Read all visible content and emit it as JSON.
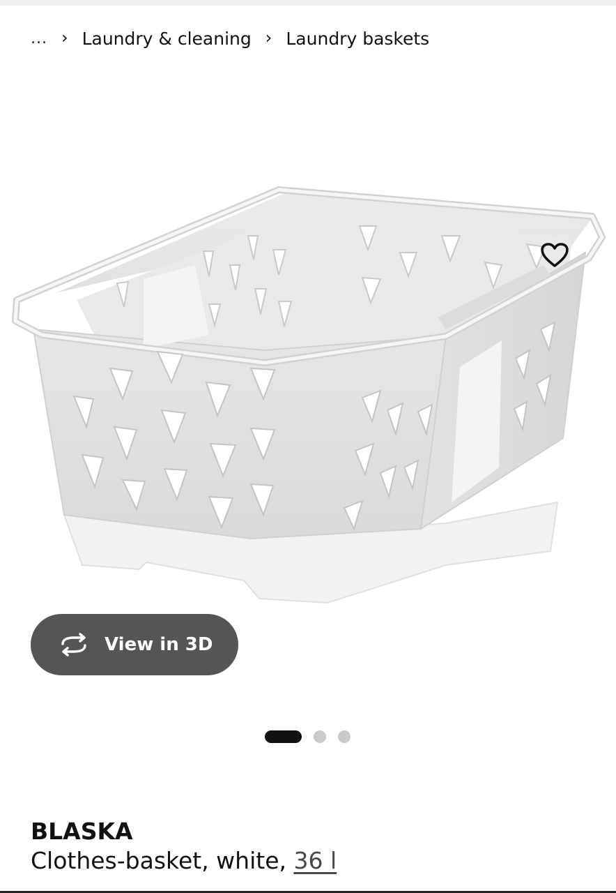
{
  "breadcrumb": {
    "more": "...",
    "items": [
      "Laundry & cleaning",
      "Laundry baskets"
    ]
  },
  "gallery": {
    "favorite_icon": "heart-outline-icon",
    "view3d_label": "View in 3D",
    "view3d_icon": "rotate-3d-icon",
    "slide_count": 3,
    "active_slide": 1
  },
  "product": {
    "name": "BLASKA",
    "description": "Clothes-basket, white, ",
    "size": "36 l"
  },
  "colors": {
    "button_bg": "#555555",
    "active_dot": "#111111",
    "inactive_dot": "#c9c9c9"
  }
}
